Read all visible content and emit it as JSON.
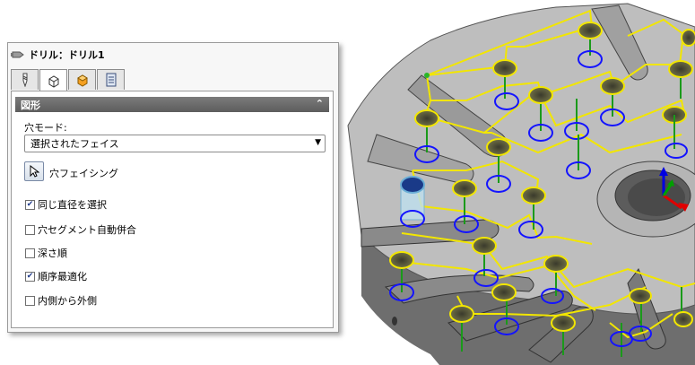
{
  "panel": {
    "title": "ドリル：ドリル1",
    "tabs": [
      {
        "icon": "drill-bit-icon"
      },
      {
        "icon": "shape-cube-icon"
      },
      {
        "icon": "stock-cube-icon"
      },
      {
        "icon": "document-icon"
      }
    ],
    "section": {
      "title": "図形",
      "collapse_glyph": "≈"
    },
    "hole_mode_label": "穴モード:",
    "hole_mode_value": "選択されたフェイス",
    "hole_facing_label": "穴フェイシング",
    "checkboxes": [
      {
        "label": "同じ直径を選択",
        "checked": true
      },
      {
        "label": "穴セグメント自動併合",
        "checked": false
      },
      {
        "label": "深さ順",
        "checked": false
      },
      {
        "label": "順序最適化",
        "checked": true
      },
      {
        "label": "内側から外側",
        "checked": false
      }
    ]
  },
  "colors": {
    "part_gray": "#bdbdbd",
    "toolpath_yellow": "#f2e600",
    "hole_top": "#4f5130",
    "bottom_circle_blue": "#1414ff",
    "drill_axis_green": "#1a9a1a",
    "triad_x": "#e00000",
    "triad_y": "#00a000",
    "triad_z": "#0000e0"
  }
}
